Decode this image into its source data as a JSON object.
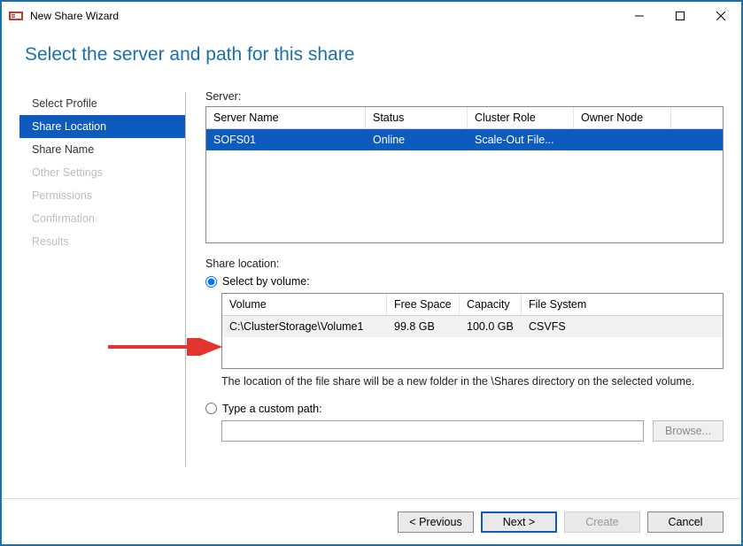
{
  "window": {
    "title": "New Share Wizard"
  },
  "page_title": "Select the server and path for this share",
  "sidebar": {
    "steps": [
      {
        "label": "Select Profile",
        "state": "done"
      },
      {
        "label": "Share Location",
        "state": "active"
      },
      {
        "label": "Share Name",
        "state": "done"
      },
      {
        "label": "Other Settings",
        "state": "disabled"
      },
      {
        "label": "Permissions",
        "state": "disabled"
      },
      {
        "label": "Confirmation",
        "state": "disabled"
      },
      {
        "label": "Results",
        "state": "disabled"
      }
    ]
  },
  "server_section": {
    "label": "Server:",
    "headers": {
      "name": "Server Name",
      "status": "Status",
      "role": "Cluster Role",
      "owner": "Owner Node"
    },
    "rows": [
      {
        "name": "SOFS01",
        "status": "Online",
        "role": "Scale-Out File...",
        "owner": ""
      }
    ]
  },
  "share_location": {
    "label": "Share location:",
    "select_by_volume_label": "Select by volume:",
    "custom_path_label": "Type a custom path:",
    "hint": "The location of the file share will be a new folder in the \\Shares directory on the selected volume.",
    "volume_headers": {
      "vol": "Volume",
      "free": "Free Space",
      "cap": "Capacity",
      "fs": "File System"
    },
    "volumes": [
      {
        "vol": "C:\\ClusterStorage\\Volume1",
        "free": "99.8 GB",
        "cap": "100.0 GB",
        "fs": "CSVFS"
      }
    ],
    "custom_path_value": "",
    "selected_option": "volume"
  },
  "buttons": {
    "browse": "Browse...",
    "previous": "< Previous",
    "next": "Next >",
    "create": "Create",
    "cancel": "Cancel"
  }
}
